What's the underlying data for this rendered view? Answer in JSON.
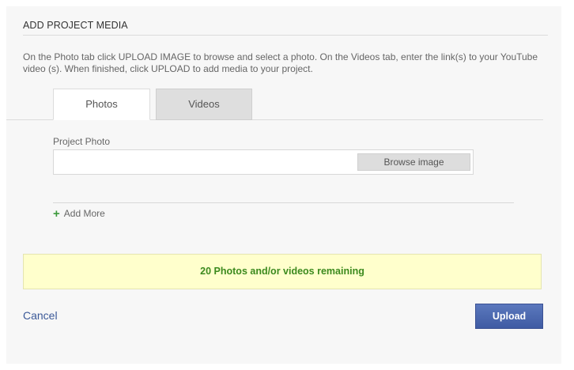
{
  "dialog": {
    "title": "ADD PROJECT MEDIA",
    "instructions": "On the Photo tab click UPLOAD IMAGE to browse and select a photo. On the Videos tab, enter the link(s) to your YouTube video (s). When finished, click UPLOAD to add media to your project."
  },
  "tabs": [
    {
      "label": "Photos",
      "active": true
    },
    {
      "label": "Videos",
      "active": false
    }
  ],
  "photo_form": {
    "field_label": "Project Photo",
    "browse_label": "Browse image",
    "file_value": ""
  },
  "add_more": {
    "icon": "plus-icon",
    "label": "Add More"
  },
  "notice": {
    "text": "20 Photos and/or videos remaining",
    "color": "#3c8a1e",
    "background": "#ffffcc"
  },
  "actions": {
    "cancel_label": "Cancel",
    "upload_label": "Upload",
    "accent": "#4a68b0"
  }
}
